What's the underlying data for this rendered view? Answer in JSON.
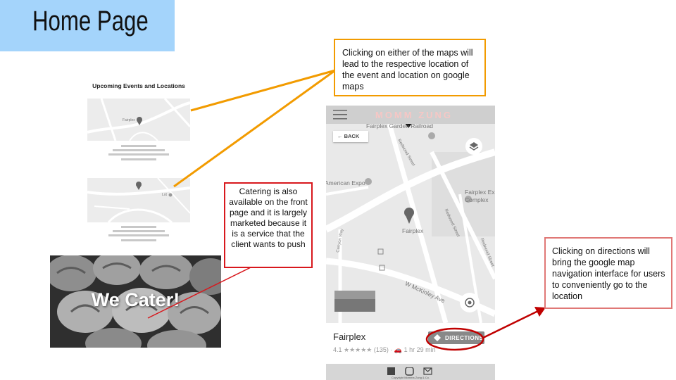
{
  "title": "Home Page",
  "mockup": {
    "heading": "Upcoming Events and Locations",
    "map1_label": "Fairplex",
    "map2_label": "Lot"
  },
  "cater_text": "We Cater!",
  "callouts": {
    "maps": "Clicking on either of the maps will lead to the respective location of the event and location on google maps",
    "catering": "Catering is also available on the front page and it is largely marketed because it is a service that the client wants to push",
    "directions": "Clicking on directions will bring the google map navigation interface for users to conveniently go to the location"
  },
  "phone": {
    "brand": "MOMM ZUNG",
    "back_label": "BACK",
    "top_place": "Fairplex Garden Railroad",
    "expo": "American Expo",
    "fairplex_ex": "Fairplex Ex",
    "complex": "Complex",
    "street1": "Redwood Street",
    "street2": "Redwood Street",
    "street3": "Redwood Street",
    "canyon_way": "Canyon Way",
    "mckinley": "W McKinley Ave",
    "map_pin_label": "Fairplex",
    "place_name": "Fairplex",
    "rating": "4.1",
    "stars": "★★★★★",
    "reviews": "(135)",
    "drive_time": "1 hr 29 min",
    "directions_label": "DIRECTIONS",
    "copyright": "Copyright Momma Zung & Co."
  },
  "colors": {
    "banner": "#a4d4fb",
    "orange": "#f29b00",
    "red": "#d8181d",
    "pink_red": "#e07876",
    "dark_red_arrow": "#c00000"
  }
}
